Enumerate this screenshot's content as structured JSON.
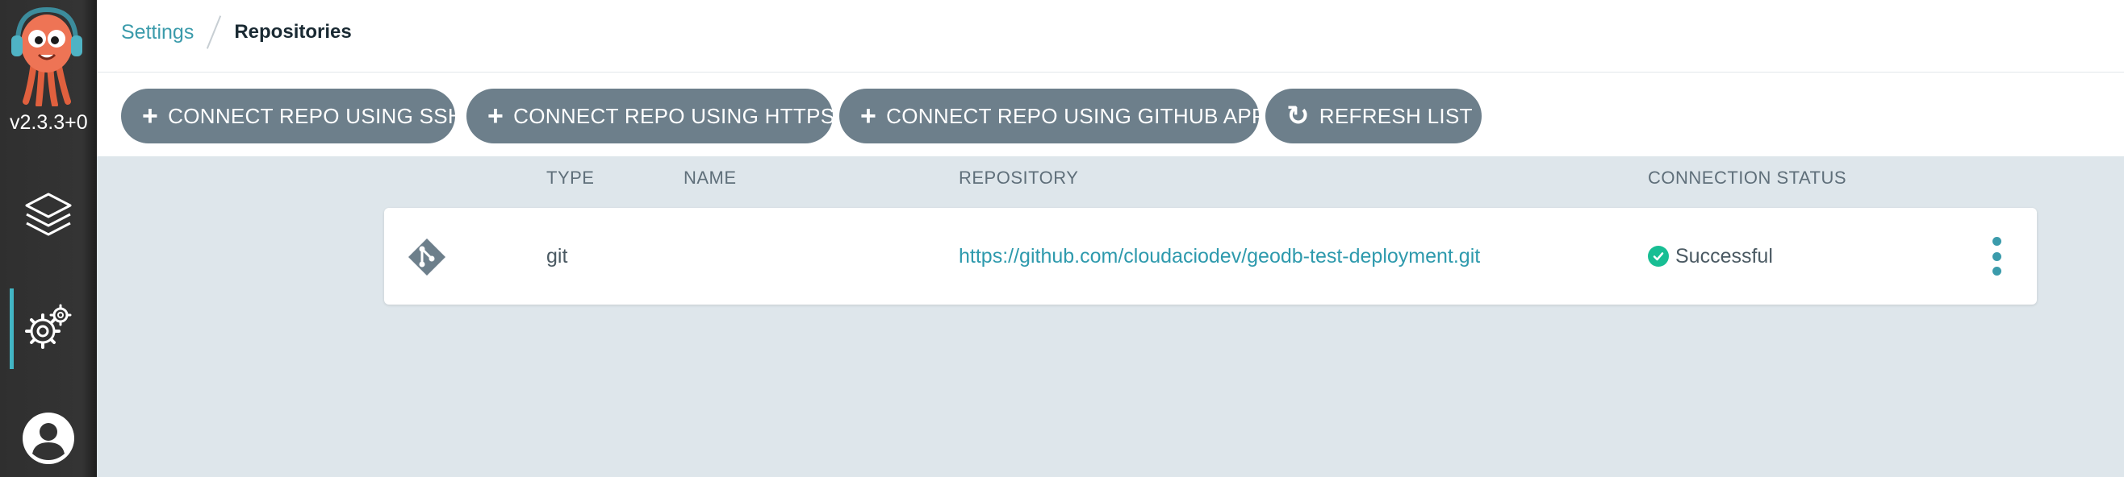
{
  "sidebar": {
    "version": "v2.3.3+0",
    "nav": [
      {
        "name": "applications",
        "icon": "layers-icon"
      },
      {
        "name": "settings",
        "icon": "gears-icon",
        "active": true
      },
      {
        "name": "user-info",
        "icon": "user-icon"
      }
    ]
  },
  "breadcrumb": {
    "parent": "Settings",
    "current": "Repositories"
  },
  "toolbar": {
    "ssh_label": "CONNECT REPO USING SSH",
    "https_label": "CONNECT REPO USING HTTPS",
    "github_label": "CONNECT REPO USING GITHUB APP",
    "refresh_label": "REFRESH LIST",
    "plus_glyph": "+",
    "refresh_glyph": "↻"
  },
  "table": {
    "headers": [
      "TYPE",
      "NAME",
      "REPOSITORY",
      "CONNECTION STATUS"
    ],
    "rows": [
      {
        "icon": "git-icon",
        "type": "git",
        "name": "",
        "repository": "https://github.com/cloudaciodev/geodb-test-deployment.git",
        "status": "Successful"
      }
    ]
  },
  "colors": {
    "accent": "#3b9bab",
    "button": "#6d7f8b",
    "success": "#18be94",
    "sidebar": "#333333",
    "background": "#dee6eb"
  }
}
